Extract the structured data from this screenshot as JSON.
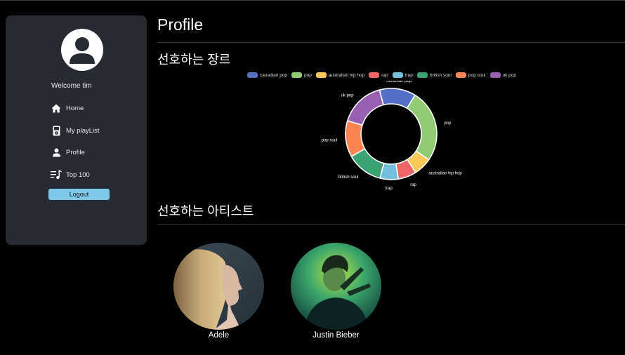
{
  "page": {
    "title": "Profile"
  },
  "sidebar": {
    "welcome": "Welcome tim",
    "items": [
      {
        "label": "Home",
        "icon": "home-icon"
      },
      {
        "label": "My playList",
        "icon": "ipod-icon"
      },
      {
        "label": "Profile",
        "icon": "person-icon"
      },
      {
        "label": "Top 100",
        "icon": "music-list-icon"
      }
    ],
    "logout_label": "Logout",
    "background": "#252a33",
    "logout_color": "#7ec8ea"
  },
  "genres": {
    "title": "선호하는 장르"
  },
  "artists": {
    "title": "선호하는 아티스트",
    "items": [
      {
        "name": "Adele"
      },
      {
        "name": "Justin Bieber"
      }
    ]
  },
  "chart_data": {
    "type": "pie",
    "variant": "doughnut",
    "legend": "top",
    "categories": [
      "canadian pop",
      "pop",
      "australian hip hop",
      "rap",
      "trap",
      "british soul",
      "pop soul",
      "uk pop"
    ],
    "values": [
      1,
      2,
      0.5,
      0.5,
      0.5,
      1,
      1,
      1.25
    ],
    "colors": [
      "#5470c6",
      "#91cc75",
      "#fac858",
      "#ee6666",
      "#73c0de",
      "#3ba272",
      "#fc8452",
      "#9a60b4"
    ]
  }
}
